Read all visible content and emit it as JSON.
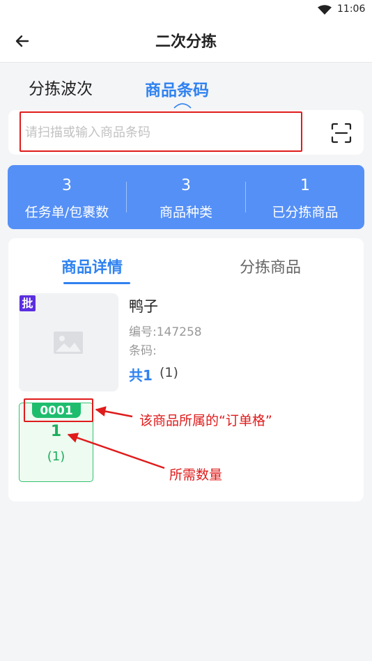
{
  "status": {
    "time": "11:06",
    "wifi_icon": "wifi-icon"
  },
  "header": {
    "title": "二次分拣",
    "back_icon": "arrow-left-icon"
  },
  "tabs": {
    "items": [
      "分拣波次",
      "商品条码"
    ],
    "active": "商品条码"
  },
  "search": {
    "placeholder": "请扫描或输入商品条码",
    "value": "",
    "scan_icon": "scan-icon"
  },
  "stats": [
    {
      "value": "3",
      "label": "任务单/包裹数"
    },
    {
      "value": "3",
      "label": "商品种类"
    },
    {
      "value": "1",
      "label": "已分拣商品"
    }
  ],
  "detail_tabs": {
    "items": [
      "商品详情",
      "分拣商品"
    ],
    "active": "商品详情"
  },
  "goods": {
    "batch_tag": "批",
    "name": "鸭子",
    "code": "编号:147258",
    "barcode": "条码:",
    "total_label": "共1",
    "total_count": "(1)",
    "image_icon": "image-placeholder-icon"
  },
  "cell": {
    "tag": "0001",
    "quantity": "1",
    "sub": "(1)"
  },
  "annotations": {
    "cell_note": "该商品所属的“订单格”",
    "quantity_note": "所需数量"
  },
  "colors": {
    "accent": "#2f82f0",
    "stats_bg": "#5590f6",
    "cell_green": "#1ebd6e",
    "annotation_red": "#e01b1b",
    "batch_purple": "#5b2ee0"
  }
}
